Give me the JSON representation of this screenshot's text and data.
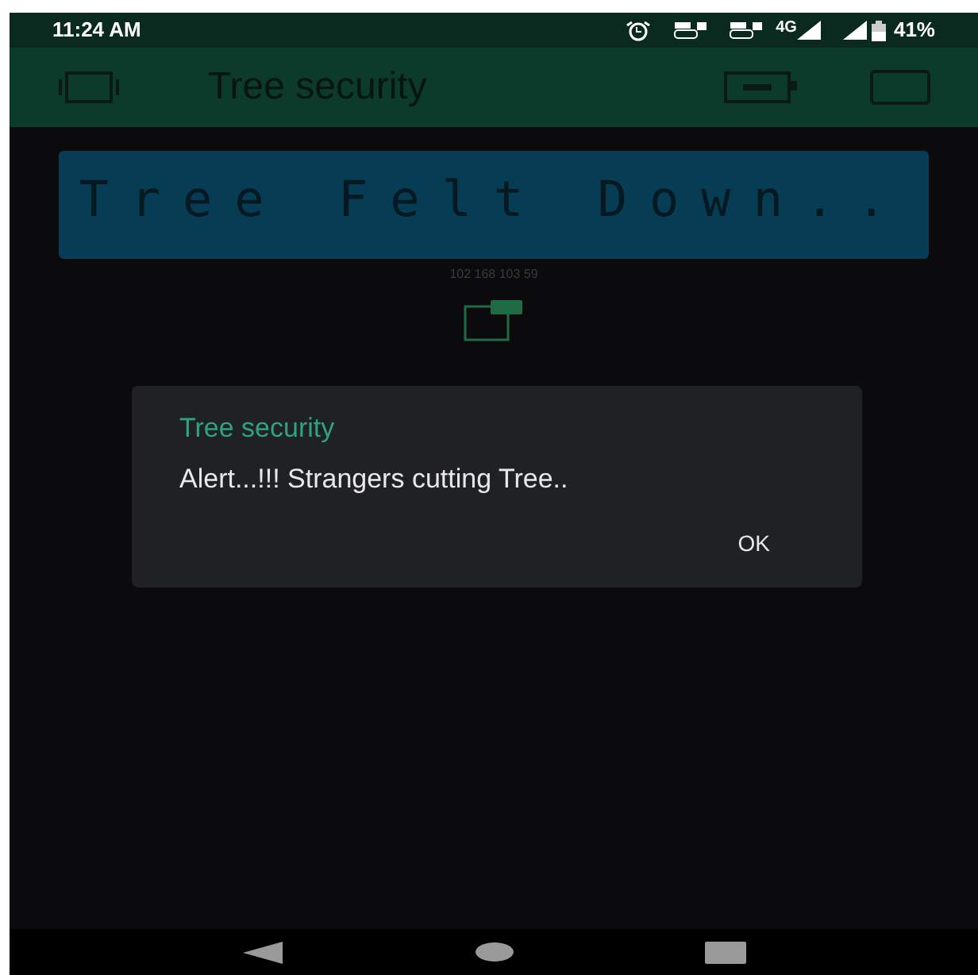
{
  "status_bar": {
    "time": "11:24 AM",
    "network": "4G",
    "battery": "41%"
  },
  "app_bar": {
    "title": "Tree security"
  },
  "lcd": {
    "text": "Tree Felt Down.."
  },
  "caption": "102 168 103 59",
  "dialog": {
    "title": "Tree security",
    "message": "Alert...!!! Strangers cutting Tree..",
    "buttons": [
      "OK"
    ]
  }
}
